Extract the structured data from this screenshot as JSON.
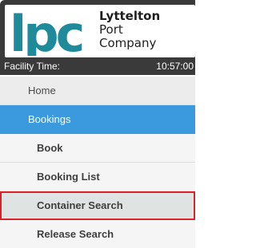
{
  "brand": {
    "logo_letters": "lpc",
    "company_line1": "Lyttelton",
    "company_line2": "Port",
    "company_line3": "Company",
    "logo_color": "#1f8a9a"
  },
  "facility": {
    "label": "Facility Time:",
    "time": "10:57:00"
  },
  "nav": {
    "home": "Home",
    "bookings": "Bookings",
    "book": "Book",
    "booking_list": "Booking List",
    "container_search": "Container Search",
    "release_search": "Release Search"
  },
  "colors": {
    "header_bg": "#3a3a3a",
    "bookings_bg": "#3b99dd",
    "active_outline": "#d8232a"
  }
}
